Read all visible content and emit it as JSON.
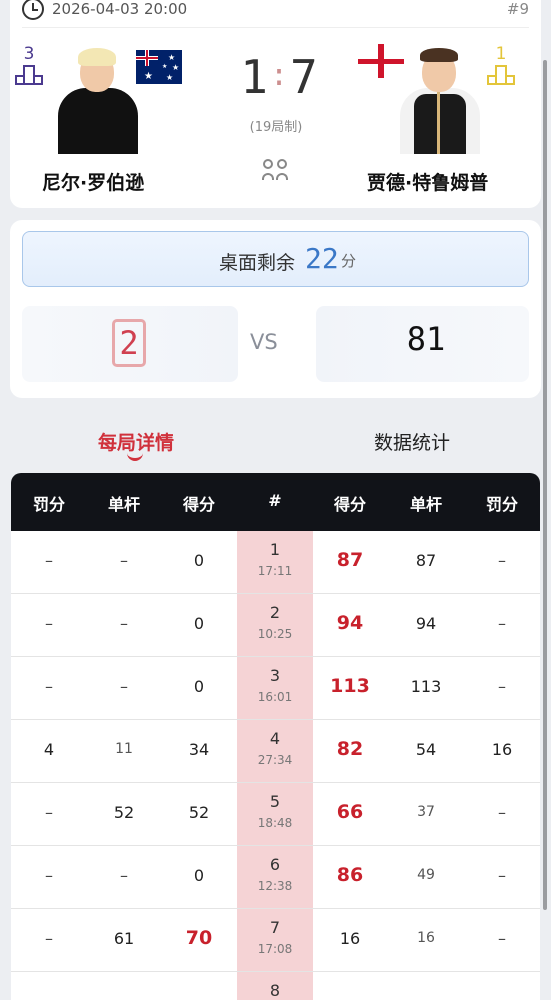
{
  "match": {
    "datetime": "2026-04-03 20:00",
    "match_no": "#9",
    "best_of": "(19局制)",
    "score_left": "1",
    "score_right": "7",
    "score_sep": ":"
  },
  "players": {
    "left": {
      "name": "尼尔·罗伯逊",
      "rank": "3",
      "rank_color": "#4b3a8f",
      "flag": "australia-flag"
    },
    "right": {
      "name": "贾德·特鲁姆普",
      "rank": "1",
      "rank_color": "#e3c53a",
      "flag": "england-flag"
    }
  },
  "remaining": {
    "label": "桌面剩余",
    "value": "22",
    "unit": "分"
  },
  "current_frame": {
    "left_score": "2",
    "vs": "VS",
    "right_score": "81"
  },
  "tabs": {
    "detail": "每局详情",
    "stats": "数据统计",
    "active": "detail"
  },
  "table": {
    "headers": [
      "罚分",
      "单杆",
      "得分",
      "#",
      "得分",
      "单杆",
      "罚分"
    ],
    "rows": [
      {
        "l_foul": "–",
        "l_break": "–",
        "l_score": "0",
        "frame": "1",
        "time": "17:11",
        "r_score": "87",
        "r_break": "87",
        "r_foul": "–",
        "winner": "right"
      },
      {
        "l_foul": "–",
        "l_break": "–",
        "l_score": "0",
        "frame": "2",
        "time": "10:25",
        "r_score": "94",
        "r_break": "94",
        "r_foul": "–",
        "winner": "right"
      },
      {
        "l_foul": "–",
        "l_break": "–",
        "l_score": "0",
        "frame": "3",
        "time": "16:01",
        "r_score": "113",
        "r_break": "113",
        "r_foul": "–",
        "winner": "right"
      },
      {
        "l_foul": "4",
        "l_break": "11",
        "l_score": "34",
        "frame": "4",
        "time": "27:34",
        "r_score": "82",
        "r_break": "54",
        "r_foul": "16",
        "winner": "right"
      },
      {
        "l_foul": "–",
        "l_break": "52",
        "l_score": "52",
        "frame": "5",
        "time": "18:48",
        "r_score": "66",
        "r_break": "37",
        "r_foul": "–",
        "winner": "right"
      },
      {
        "l_foul": "–",
        "l_break": "–",
        "l_score": "0",
        "frame": "6",
        "time": "12:38",
        "r_score": "86",
        "r_break": "49",
        "r_foul": "–",
        "winner": "right"
      },
      {
        "l_foul": "–",
        "l_break": "61",
        "l_score": "70",
        "frame": "7",
        "time": "17:08",
        "r_score": "16",
        "r_break": "16",
        "r_foul": "–",
        "winner": "left"
      },
      {
        "l_foul": "",
        "l_break": "",
        "l_score": "",
        "frame": "8",
        "time": "",
        "r_score": "",
        "r_break": "",
        "r_foul": "",
        "winner": "right"
      }
    ]
  },
  "colors": {
    "accent_red": "#c8212c",
    "header_dark": "#111318",
    "frame_col": "#f5d3d5",
    "blue": "#3b78c7"
  }
}
